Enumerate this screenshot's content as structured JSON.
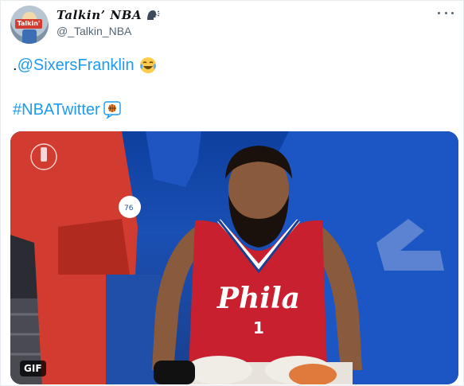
{
  "tweet": {
    "display_name": "Talkin’ NBA",
    "handle": "@_Talkin_NBA",
    "avatar_text": "Talkin'",
    "line1_prefix": ".",
    "mention": "@SixersFranklin",
    "hashtag": "#NBATwitter",
    "jersey_text": "Phila",
    "jersey_number": "1",
    "gif_badge": "GIF"
  },
  "icons": {
    "speaking_head": "speaking-head-icon",
    "laughing": "face-with-tears-of-joy-icon",
    "hashtag_emoji": "nba-basketball-icon",
    "more": "more-icon"
  },
  "colors": {
    "link": "#1d9bf0",
    "secondary_text": "#536471",
    "jersey": "#c8202f",
    "court_blue": "#1a4fb3"
  }
}
